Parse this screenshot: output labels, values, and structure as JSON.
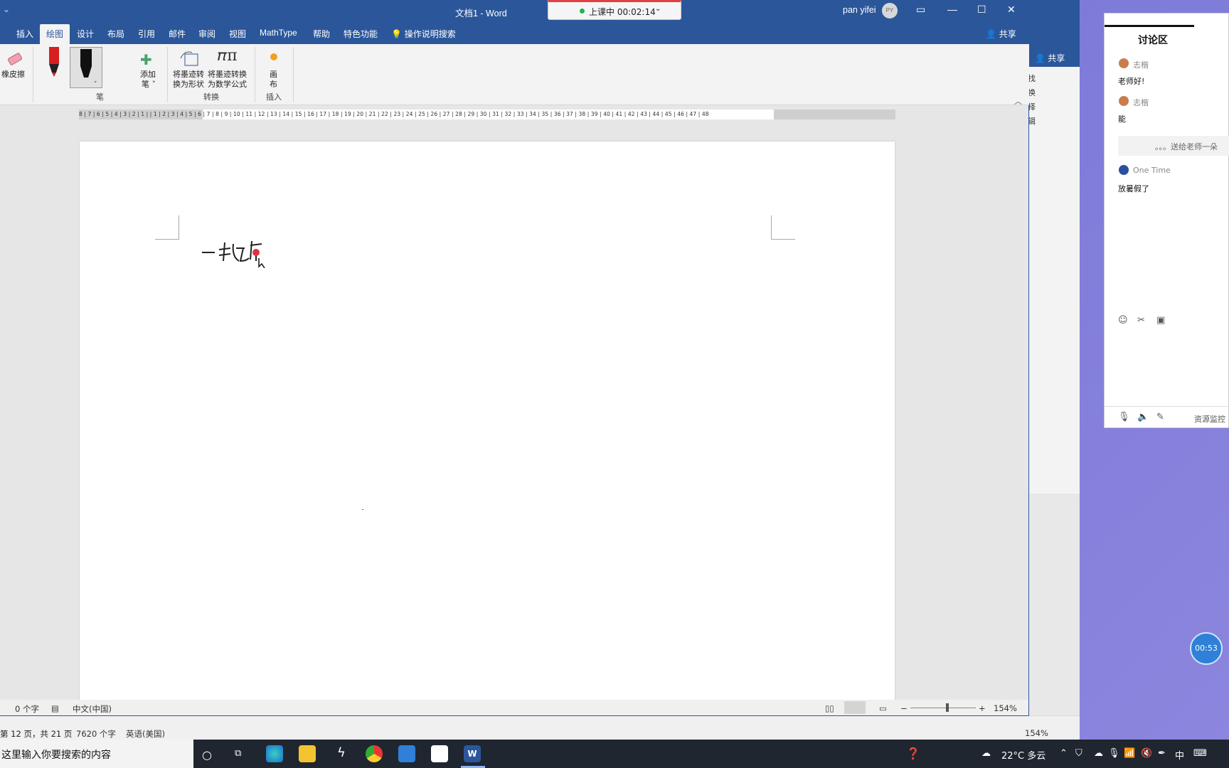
{
  "bg_window": {
    "share": "共享",
    "side_chars": [
      "找",
      "换",
      "择",
      "辑"
    ],
    "status": {
      "page": "第 12 页，共 21 页",
      "words": "7620 个字",
      "lang": "英语(美国)",
      "zoom": "154%"
    }
  },
  "word": {
    "title": "文档1  -  Word",
    "user": "pan yifei",
    "avatar_initials": "PY",
    "class_timer": "上课中 00:02:14",
    "tabs": [
      "插入",
      "绘图",
      "设计",
      "布局",
      "引用",
      "邮件",
      "审阅",
      "视图",
      "MathType",
      "帮助",
      "特色功能"
    ],
    "active_tab": "绘图",
    "search": "操作说明搜索",
    "share": "共享",
    "ribbon": {
      "eraser": "橡皮擦",
      "add_pen_1": "添加",
      "add_pen_2": "笔 ˅",
      "ink_to_shape_1": "将墨迹转",
      "ink_to_shape_2": "换为形状",
      "ink_to_math_1": "将墨迹转换",
      "ink_to_math_2": "为数学公式",
      "canvas_1": "画",
      "canvas_2": "布",
      "group_pen": "笔",
      "group_convert": "转换",
      "group_insert": "插入"
    },
    "ruler_text": "8 | 7 | 6 | 5 | 4 | 3 | 2 | 1 |   | 1 | 2 | 3 | 4 | 5 | 6 | 7 | 8 | 9 | 10 | 11 | 12 | 13 | 14 | 15 | 16 | 17 | 18 | 19 | 20 | 21 | 22 | 23 | 24 | 25 | 26 | 27 | 28 | 29 | 30 | 31 | 32 | 33 | 34 | 35 | 36 | 37 | 38 | 39 | 40 | 41 | 42 | 43 | 44 | 45 | 46 | 47 | 48",
    "status": {
      "words": "0 个字",
      "lang": "中文(中国)",
      "zoom": "154%"
    }
  },
  "chat": {
    "title": "讨论区",
    "messages": [
      {
        "name": "志楷",
        "text": "老师好!"
      },
      {
        "name": "志楷",
        "text": "能"
      },
      {
        "name": "One Time",
        "text": "放暑假了"
      }
    ],
    "gift_text": "。。。送给老师一朵",
    "resource_monitor": "资源监控"
  },
  "countdown": "00:53",
  "taskbar": {
    "search_placeholder": "这里输入你要搜索的内容",
    "weather": "22°C  多云",
    "ime": "中"
  }
}
